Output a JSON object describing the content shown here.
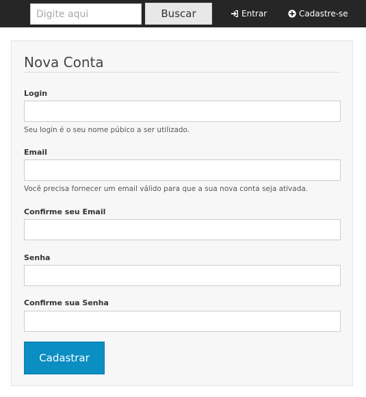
{
  "header": {
    "search": {
      "placeholder": "Digite aqui",
      "value": ""
    },
    "search_button_label": "Buscar",
    "login_label": "Entrar",
    "signup_label": "Cadastre-se"
  },
  "form": {
    "title": "Nova Conta",
    "fields": [
      {
        "label": "Login",
        "value": "",
        "help": "Seu login é o seu nome púbico a ser utilizado."
      },
      {
        "label": "Email",
        "value": "",
        "help": "Você precisa fornecer um email válido para que a sua nova conta seja ativada."
      },
      {
        "label": "Confirme seu Email",
        "value": ""
      },
      {
        "label": "Senha",
        "value": ""
      },
      {
        "label": "Confirme sua Senha",
        "value": ""
      }
    ],
    "submit_label": "Cadastrar"
  },
  "colors": {
    "topbar": "#262626",
    "accent": "#0b8ec1",
    "panel": "#f7f7f7"
  },
  "icons": {
    "login": "sign-in-icon",
    "signup": "plus-circle-icon"
  }
}
